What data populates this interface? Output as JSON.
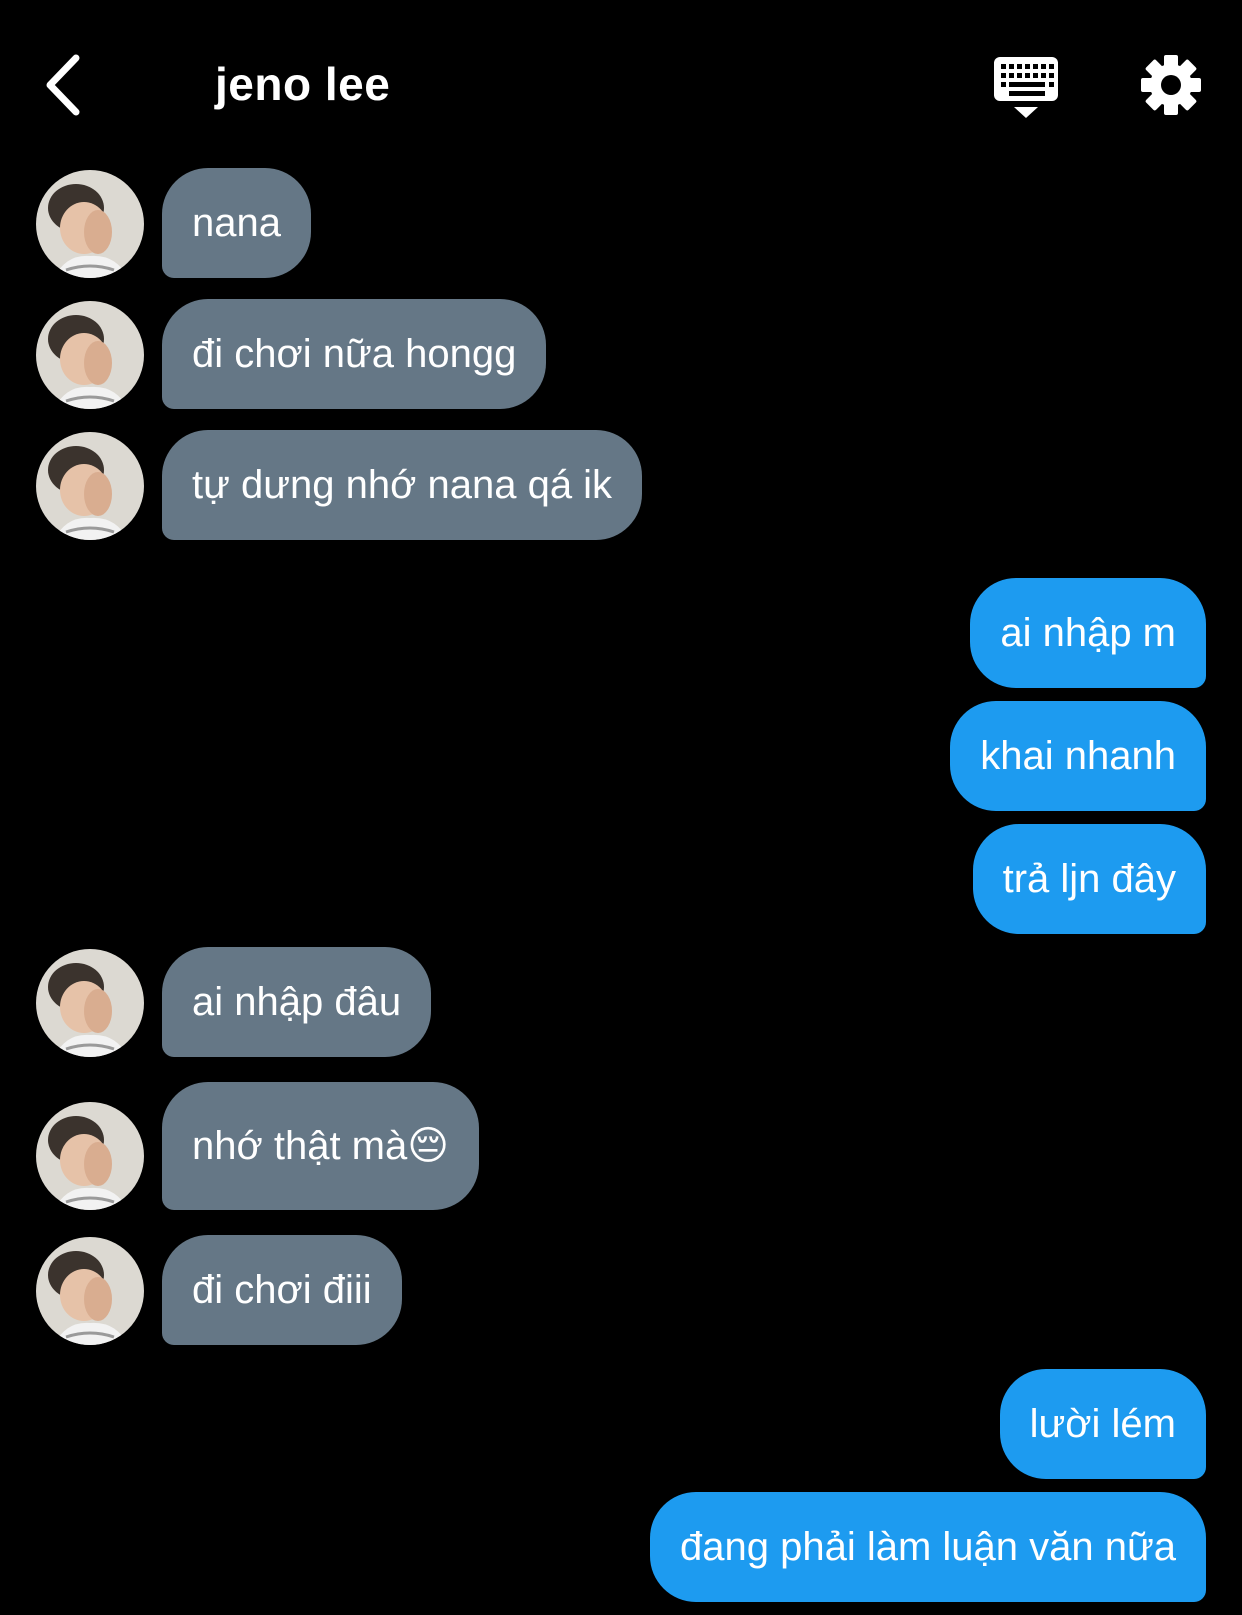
{
  "header": {
    "title": "jeno lee"
  },
  "icons": {
    "back": "chevron-left-icon",
    "keyboard": "keyboard-icon",
    "settings": "gear-icon"
  },
  "colors": {
    "background": "#000000",
    "incoming_bubble": "#657786",
    "outgoing_bubble": "#1d9bf0",
    "text": "#ffffff"
  },
  "messages": [
    {
      "direction": "in",
      "text": "nana"
    },
    {
      "direction": "in",
      "text": "đi chơi nữa hongg"
    },
    {
      "direction": "in",
      "text": "tự dưng nhớ nana qá ik"
    },
    {
      "direction": "out",
      "text": "ai nhập m"
    },
    {
      "direction": "out",
      "text": "khai nhanh"
    },
    {
      "direction": "out",
      "text": "trả ljn đây"
    },
    {
      "direction": "in",
      "text": "ai nhập đâu"
    },
    {
      "direction": "in",
      "text": "nhớ thật mà😔"
    },
    {
      "direction": "in",
      "text": "đi chơi điii"
    },
    {
      "direction": "out",
      "text": "lười lém"
    },
    {
      "direction": "out",
      "text": "đang phải làm luận văn nữa"
    }
  ]
}
